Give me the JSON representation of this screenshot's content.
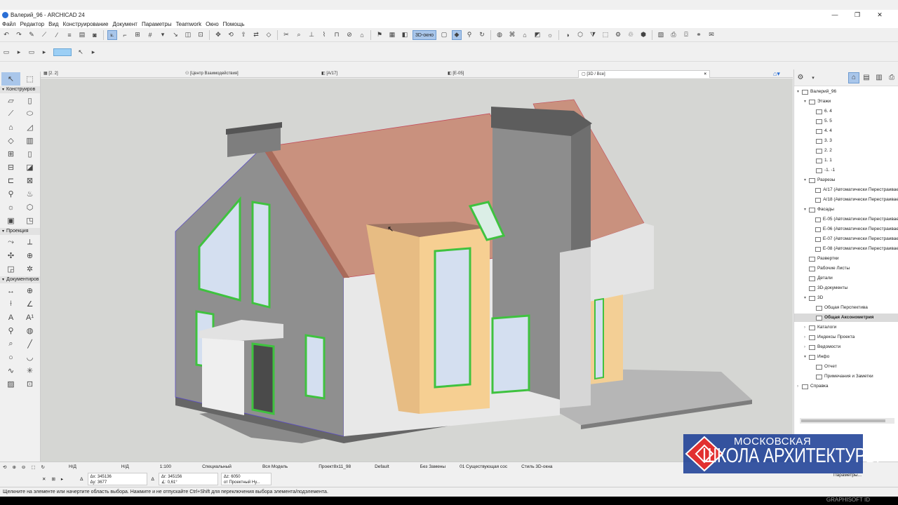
{
  "window": {
    "title": "Валерий_96 - ARCHICAD 24",
    "min": "—",
    "max": "❐",
    "close": "✕"
  },
  "menu": [
    "Файл",
    "Редактор",
    "Вид",
    "Конструирование",
    "Документ",
    "Параметры",
    "Teamwork",
    "Окно",
    "Помощь"
  ],
  "toolbar": {
    "btn_3d": "3D-окно"
  },
  "toolbox": {
    "group_design": "Конструиров",
    "group_view": "Проекция",
    "group_doc": "Документиров"
  },
  "tabs": [
    "[2. 2]",
    "[Центр Взаимодействия]",
    "[A/17]",
    "[E-05]",
    "[3D / Все]"
  ],
  "tab_close": "×",
  "navigator": {
    "items": [
      {
        "label": "Валерий_96",
        "level": 0,
        "ex": "▾"
      },
      {
        "label": "Этажи",
        "level": 1,
        "ex": "▾"
      },
      {
        "label": "6. 4",
        "level": 2,
        "ex": ""
      },
      {
        "label": "5. 5",
        "level": 2,
        "ex": ""
      },
      {
        "label": "4. 4",
        "level": 2,
        "ex": ""
      },
      {
        "label": "3. 3",
        "level": 2,
        "ex": ""
      },
      {
        "label": "2. 2",
        "level": 2,
        "ex": ""
      },
      {
        "label": "1. 1",
        "level": 2,
        "ex": ""
      },
      {
        "label": "-1. -1",
        "level": 2,
        "ex": ""
      },
      {
        "label": "Разрезы",
        "level": 1,
        "ex": "▾"
      },
      {
        "label": "A/17 (Автоматически Перестраивае",
        "level": 2,
        "ex": ""
      },
      {
        "label": "A/18 (Автоматически Перестраивае",
        "level": 2,
        "ex": ""
      },
      {
        "label": "Фасады",
        "level": 1,
        "ex": "▾"
      },
      {
        "label": "E-05 (Автоматически Перестраивае",
        "level": 2,
        "ex": ""
      },
      {
        "label": "E-06 (Автоматически Перестраивае",
        "level": 2,
        "ex": ""
      },
      {
        "label": "E-07 (Автоматически Перестраивае",
        "level": 2,
        "ex": ""
      },
      {
        "label": "E-08 (Автоматически Перестраивае",
        "level": 2,
        "ex": ""
      },
      {
        "label": "Развертки",
        "level": 1,
        "ex": ""
      },
      {
        "label": "Рабочие Листы",
        "level": 1,
        "ex": ""
      },
      {
        "label": "Детали",
        "level": 1,
        "ex": ""
      },
      {
        "label": "3D-документы",
        "level": 1,
        "ex": ""
      },
      {
        "label": "3D",
        "level": 1,
        "ex": "▾"
      },
      {
        "label": "Общая Перспектива",
        "level": 2,
        "ex": ""
      },
      {
        "label": "Общая Аксонометрия",
        "level": 2,
        "ex": "",
        "sel": true
      },
      {
        "label": "Каталоги",
        "level": 1,
        "ex": "›"
      },
      {
        "label": "Индексы Проекта",
        "level": 1,
        "ex": "›"
      },
      {
        "label": "Ведомости",
        "level": 1,
        "ex": "›"
      },
      {
        "label": "Инфо",
        "level": 1,
        "ex": "▾"
      },
      {
        "label": "Отчет",
        "level": 2,
        "ex": ""
      },
      {
        "label": "Примечания и Заметки",
        "level": 2,
        "ex": ""
      },
      {
        "label": "Справка",
        "level": 0,
        "ex": "›"
      }
    ]
  },
  "status_bar": {
    "nd1": "Н/Д",
    "nd2": "Н/Д",
    "scale": "1:100",
    "view_mode": "Специальный",
    "model": "Вся Модель",
    "pen": "Проект8х11_98",
    "style": "Default",
    "override": "Без Замены",
    "reno": "01 Существующая сос",
    "style3d": "Стиль 3D-окна",
    "params": "Параметры..."
  },
  "coords": {
    "dx": "Δx: 345136",
    "dy": "Δy: 3677",
    "dr": "Δr: 345156",
    "ang": "∡: 0,61°",
    "dz": "Δz: 6050",
    "from": "от Проектный Ну..."
  },
  "hint": "Щелкните на элементе или начертите область выбора. Нажмите и не отпускайте Ctrl+Shift для переключения выбора элемента/подэлемента.",
  "watermark": {
    "line1": "МОСКОВСКАЯ",
    "line2": "ШКОЛА АРХИТЕКТУРЫ"
  },
  "brand": "GRAPHISOFT ID",
  "colors": {
    "roof": "#c9907c",
    "wall": "#8e8e8e",
    "accent": "#f5cb8c",
    "window_frame": "#3fc23f"
  }
}
